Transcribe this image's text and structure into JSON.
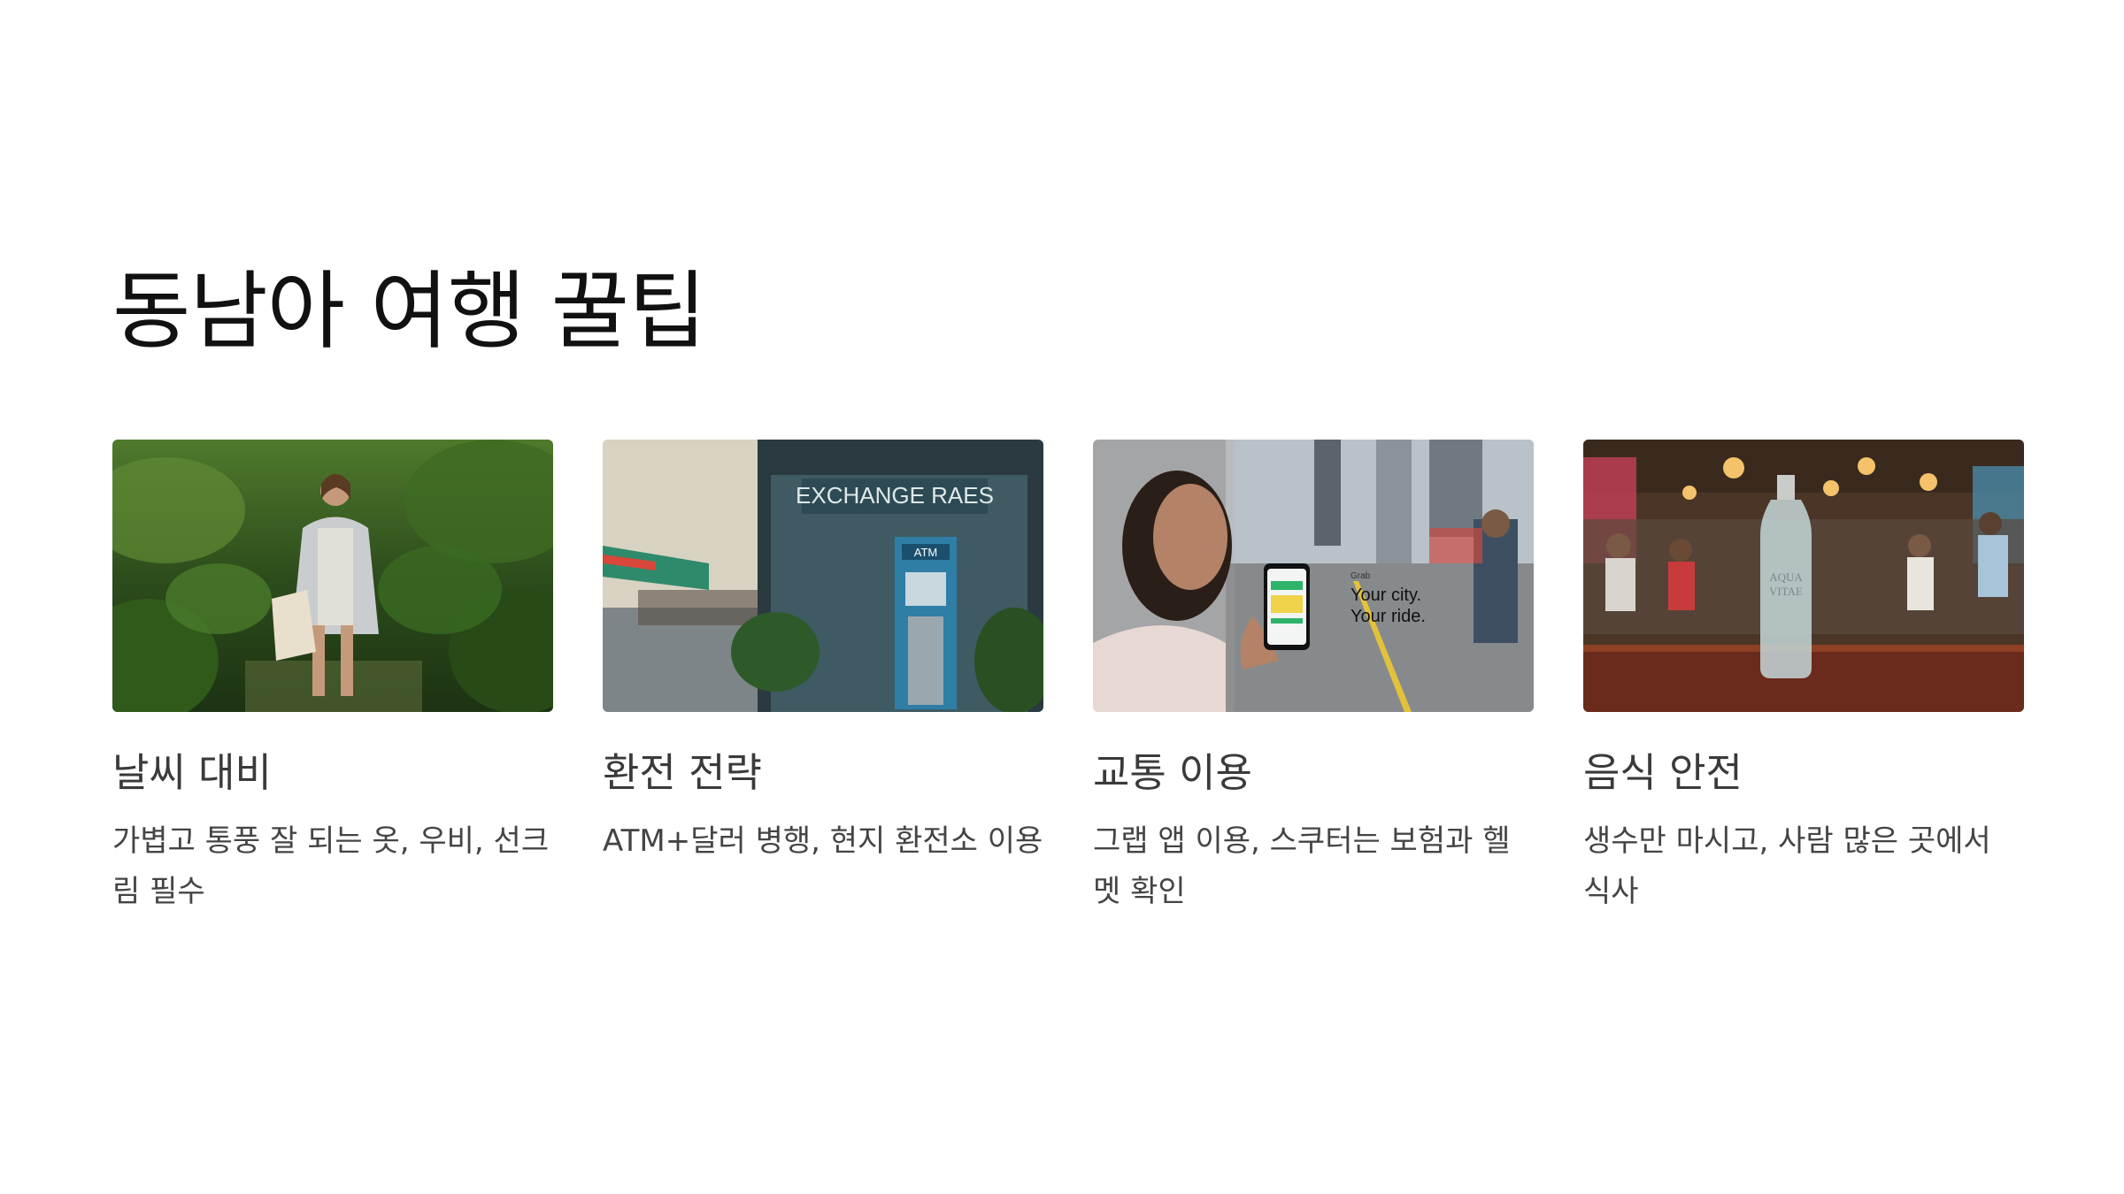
{
  "slide": {
    "title": "동남아 여행 꿀팁"
  },
  "cards": [
    {
      "image": "person-in-jungle-photo",
      "title": "날씨 대비",
      "description": "가볍고 통풍 잘 되는 옷, 우비, 선크림 필수",
      "image_text": []
    },
    {
      "image": "exchange-booth-atm-photo",
      "title": "환전 전략",
      "description": "ATM+달러 병행, 현지 환전소 이용",
      "image_text": [
        "EXCHANGE RAES",
        "ATM"
      ]
    },
    {
      "image": "woman-with-ride-app-photo",
      "title": "교통 이용",
      "description": "그랩 앱 이용, 스쿠터는 보험과 헬멧 확인",
      "image_text": [
        "Grab",
        "Your city.",
        "Your ride."
      ]
    },
    {
      "image": "restaurant-water-bottle-photo",
      "title": "음식 안전",
      "description": "생수만 마시고, 사람 많은 곳에서 식사",
      "image_text": [
        "AQUA",
        "VITAE"
      ]
    }
  ]
}
